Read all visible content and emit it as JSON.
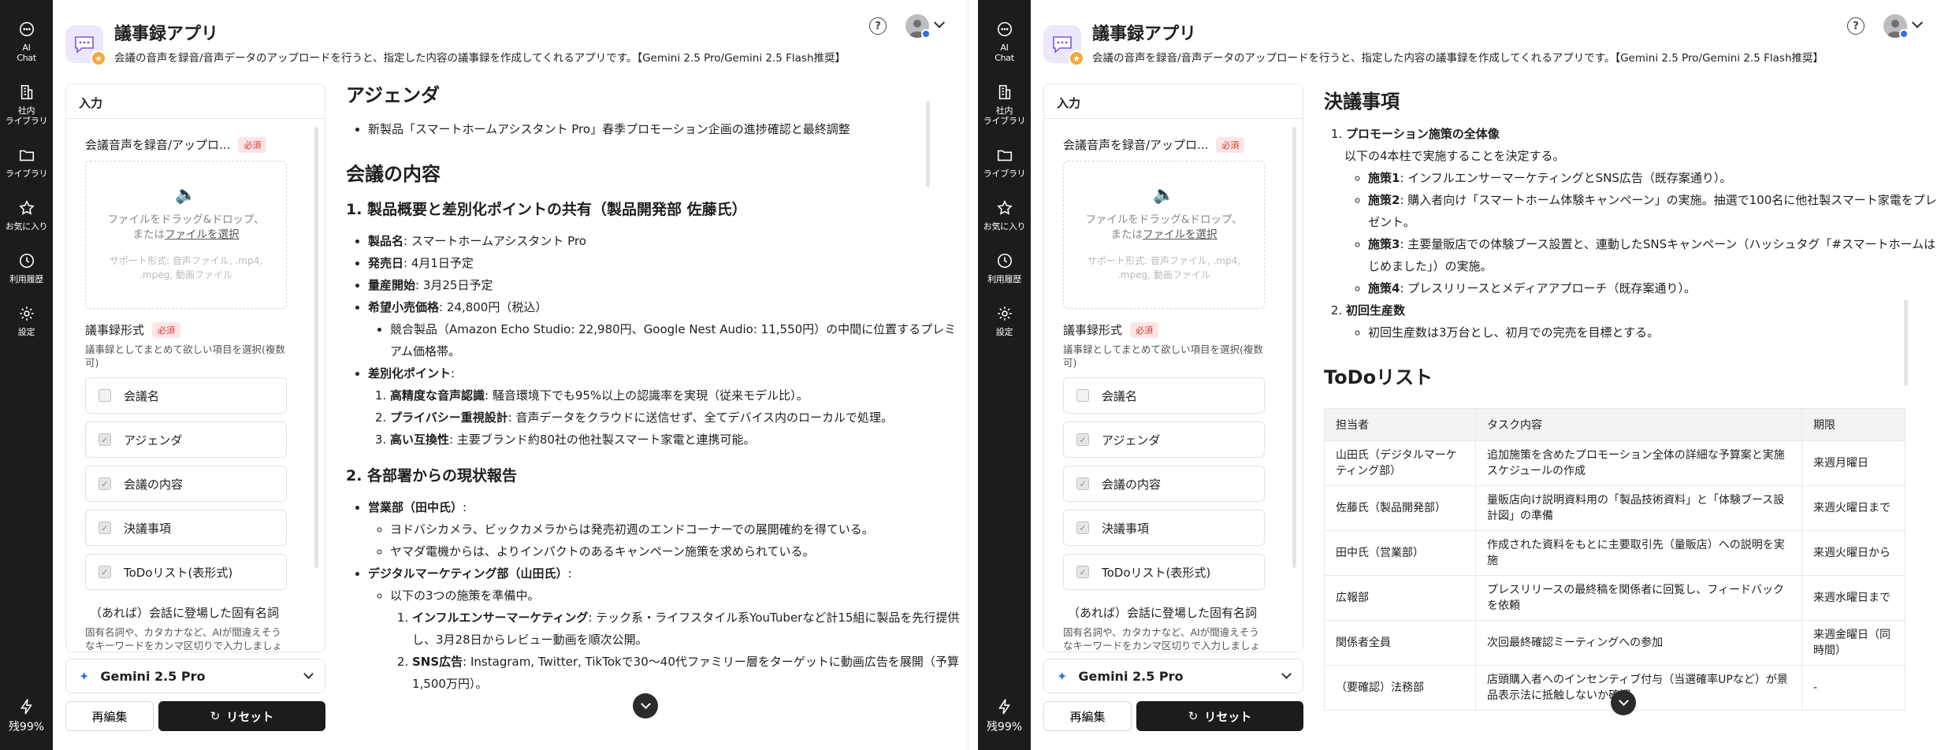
{
  "rail": {
    "items": [
      {
        "label": "AI\nChat",
        "icon": "chat-icon"
      },
      {
        "label": "社内\nライブラリ",
        "icon": "building-icon"
      },
      {
        "label": "ライブラリ",
        "icon": "folder-icon"
      },
      {
        "label": "お気に入り",
        "icon": "star-icon"
      },
      {
        "label": "利用履歴",
        "icon": "history-icon"
      },
      {
        "label": "設定",
        "icon": "gear-icon"
      }
    ],
    "quota": "残99%"
  },
  "header": {
    "title": "議事録アプリ",
    "description": "会議の音声を録音/音声データのアップロードを行うと、指定した内容の議事録を作成してくれるアプリです。【Gemini 2.5 Pro/Gemini 2.5 Flash推奨】",
    "help": "?"
  },
  "input": {
    "heading": "入力",
    "audio_label": "会議音声を録音/アップロ...",
    "required": "必須",
    "drop_line1": "ファイルをドラッグ&ドロップ、",
    "drop_line2_prefix": "または",
    "drop_link": "ファイルを選択",
    "drop_formats": "サポート形式: 音声ファイル, .mp4, .mpeg, 動画ファイル",
    "format_label": "議事録形式",
    "format_desc": "議事録としてまとめて欲しい項目を選択(複数可)",
    "options": [
      {
        "label": "会議名",
        "checked": false
      },
      {
        "label": "アジェンダ",
        "checked": true
      },
      {
        "label": "会議の内容",
        "checked": true
      },
      {
        "label": "決議事項",
        "checked": true
      },
      {
        "label": "ToDoリスト(表形式)",
        "checked": true
      }
    ],
    "proper_label": "（あれば）会話に登場した固有名詞",
    "proper_desc": "固有名詞や、カタカナなど、AIが間違えそうなキーワードをカンマ区切りで入力しましょう。"
  },
  "model": {
    "name": "Gemini 2.5 Pro"
  },
  "buttons": {
    "edit": "再編集",
    "reset": "リセット"
  },
  "left_output": {
    "agenda_title": "アジェンダ",
    "agenda_item": "新製品「スマートホームアシスタント Pro」春季プロモーション企画の進捗確認と最終調整",
    "content_title": "会議の内容",
    "s1_title": "1. 製品概要と差別化ポイントの共有（製品開発部 佐藤氏）",
    "s1_items": [
      {
        "k": "製品名",
        "v": ": スマートホームアシスタント Pro"
      },
      {
        "k": "発売日",
        "v": ": 4月1日予定"
      },
      {
        "k": "量産開始",
        "v": ": 3月25日予定"
      },
      {
        "k": "希望小売価格",
        "v": ": 24,800円（税込）"
      }
    ],
    "s1_competitor": "競合製品（Amazon Echo Studio: 22,980円、Google Nest Audio: 11,550円）の中間に位置するプレミアム価格帯。",
    "s1_diff_label": "差別化ポイント",
    "s1_diff_suffix": ":",
    "s1_diff": [
      {
        "k": "高精度な音声認識",
        "v": ": 騒音環境下でも95%以上の認識率を実現（従来モデル比）。"
      },
      {
        "k": "プライバシー重視設計",
        "v": ": 音声データをクラウドに送信せず、全てデバイス内のローカルで処理。"
      },
      {
        "k": "高い互換性",
        "v": ": 主要ブランド約80社の他社製スマート家電と連携可能。"
      }
    ],
    "s2_title": "2. 各部署からの現状報告",
    "sales_label": "営業部（田中氏）",
    "sales_suffix": ":",
    "sales_items": [
      "ヨドバシカメラ、ビックカメラからは発売初週のエンドコーナーでの展開確約を得ている。",
      "ヤマダ電機からは、よりインパクトのあるキャンペーン施策を求められている。"
    ],
    "dm_label": "デジタルマーケティング部（山田氏）",
    "dm_suffix": ":",
    "dm_intro": "以下の3つの施策を準備中。",
    "dm_items": [
      {
        "k": "インフルエンサーマーケティング",
        "v": ": テック系・ライフスタイル系YouTuberなど計15組に製品を先行提供し、3月28日からレビュー動画を順次公開。"
      },
      {
        "k": "SNS広告",
        "v": ": Instagram, Twitter, TikTokで30〜40代ファミリー層をターゲットに動画広告を展開（予算1,500万円）。"
      }
    ]
  },
  "right_output": {
    "decisions_title": "決議事項",
    "d1_title": "プロモーション施策の全体像",
    "d1_intro": "以下の4本柱で実施することを決定する。",
    "d1_items": [
      {
        "k": "施策1",
        "v": ": インフルエンサーマーケティングとSNS広告（既存案通り）。"
      },
      {
        "k": "施策2",
        "v": ": 購入者向け「スマートホーム体験キャンペーン」の実施。抽選で100名に他社製スマート家電をプレゼント。"
      },
      {
        "k": "施策3",
        "v": ": 主要量販店での体験ブース設置と、連動したSNSキャンペーン（ハッシュタグ「#スマートホームはじめました」）の実施。"
      },
      {
        "k": "施策4",
        "v": ": プレスリリースとメディアアプローチ（既存案通り）。"
      }
    ],
    "d2_title": "初回生産数",
    "d2_items": [
      "初回生産数は3万台とし、初月での完売を目標とする。"
    ],
    "todo_title": "ToDoリスト",
    "todo_headers": [
      "担当者",
      "タスク内容",
      "期限"
    ],
    "todo_rows": [
      [
        "山田氏（デジタルマーケティング部）",
        "追加施策を含めたプロモーション全体の詳細な予算案と実施スケジュールの作成",
        "来週月曜日"
      ],
      [
        "佐藤氏（製品開発部）",
        "量販店向け説明資料用の「製品技術資料」と「体験ブース設計図」の準備",
        "来週火曜日まで"
      ],
      [
        "田中氏（営業部）",
        "作成された資料をもとに主要取引先（量販店）への説明を実施",
        "来週火曜日から"
      ],
      [
        "広報部",
        "プレスリリースの最終稿を関係者に回覧し、フィードバックを依頼",
        "来週水曜日まで"
      ],
      [
        "関係者全員",
        "次回最終確認ミーティングへの参加",
        "来週金曜日（同時間）"
      ],
      [
        "（要確認）法務部",
        "店頭購入者へのインセンティブ付与（当選確率UPなど）が景品表示法に抵触しないか確認",
        "-"
      ]
    ]
  }
}
